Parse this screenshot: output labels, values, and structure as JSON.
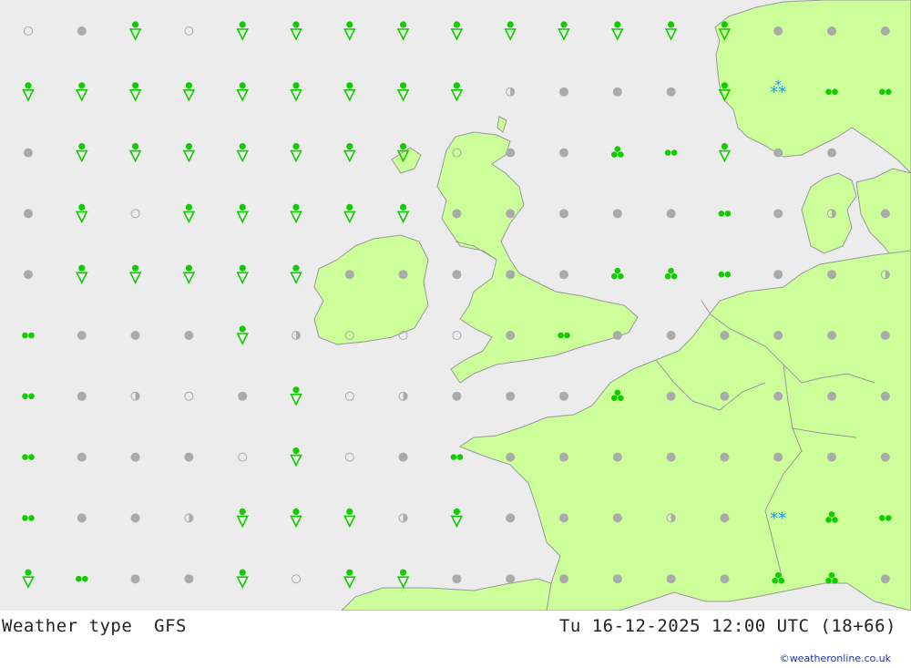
{
  "title": "Weather type",
  "model": "GFS",
  "valid_time": "Tu 16-12-2025 12:00 UTC (18+66)",
  "credit": "©weatheronline.co.uk",
  "colors": {
    "sea": "#ececec",
    "land": "#ccff99",
    "border": "#999999",
    "rain": "#11cc00",
    "cloud": "#aaaaaa",
    "snow": "#1199ff"
  },
  "legend_symbols": {
    "c": "cloud-overcast",
    "h": "cloud-half",
    "o": "cloud-clear",
    "s": "rain-shower",
    "d": "rain-light",
    "r": "rain-heavy",
    "x": "snow",
    "y": "snow-shower"
  },
  "grid": [
    "ocsossssssssssccc",
    "ssssssssshcccsy dd",
    "csssssss occ rdsc c",
    "csossssscccccdchc",
    "cssssscccccr rdcch",
    "dcccshooocdccccccho",
    "dchocsohcccrcccccho",
    "dcccosocdcccccccco",
    "dcchssshsccchcxrd",
    "sdccsossccccccr rc"
  ]
}
